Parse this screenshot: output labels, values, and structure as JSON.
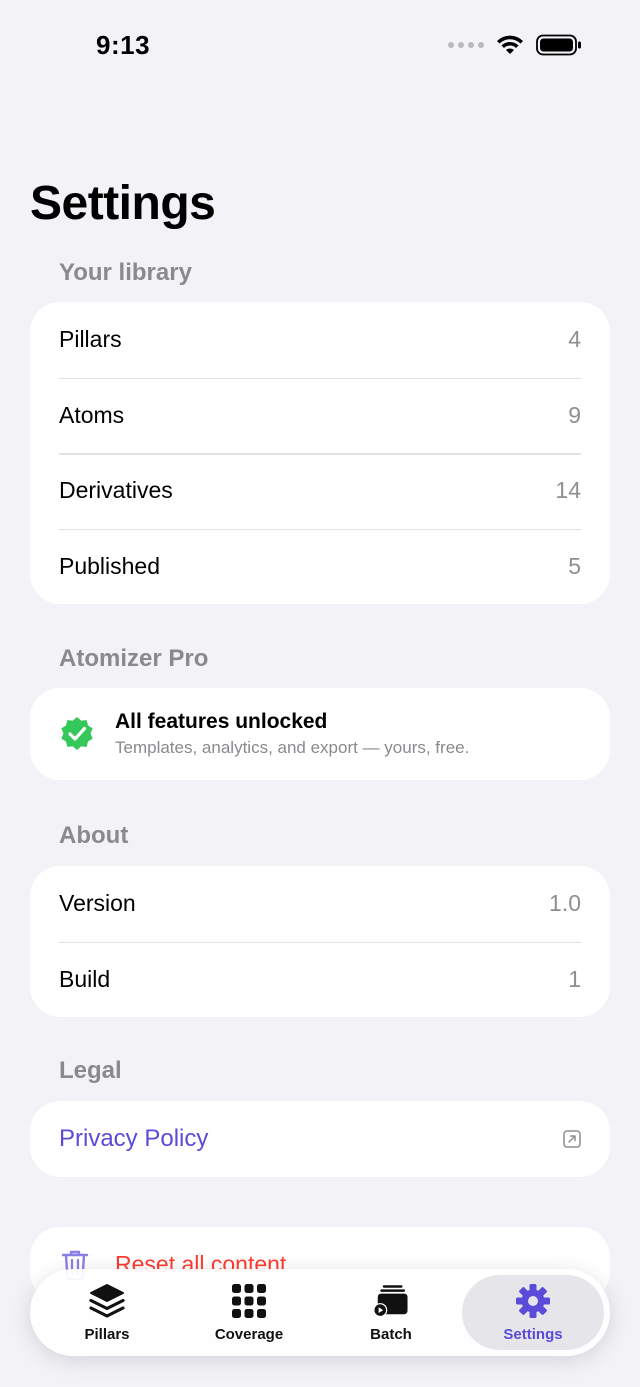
{
  "status_bar": {
    "time": "9:13"
  },
  "page": {
    "title": "Settings"
  },
  "library": {
    "header": "Your library",
    "rows": [
      {
        "label": "Pillars",
        "value": "4"
      },
      {
        "label": "Atoms",
        "value": "9"
      },
      {
        "label": "Derivatives",
        "value": "14"
      },
      {
        "label": "Published",
        "value": "5"
      }
    ]
  },
  "pro": {
    "header": "Atomizer Pro",
    "title": "All features unlocked",
    "subtitle": "Templates, analytics, and export — yours, free."
  },
  "about": {
    "header": "About",
    "rows": [
      {
        "label": "Version",
        "value": "1.0"
      },
      {
        "label": "Build",
        "value": "1"
      }
    ]
  },
  "legal": {
    "header": "Legal",
    "privacy_label": "Privacy Policy"
  },
  "danger": {
    "reset_label": "Reset all content"
  },
  "tabs": [
    {
      "label": "Pillars",
      "icon": "stack-icon"
    },
    {
      "label": "Coverage",
      "icon": "grid-icon"
    },
    {
      "label": "Batch",
      "icon": "batch-icon"
    },
    {
      "label": "Settings",
      "icon": "gear-icon",
      "active": true
    }
  ],
  "colors": {
    "accent": "#5a4bd8",
    "success": "#34c759",
    "destructive": "#ff3b30",
    "background": "#f2f2f7"
  }
}
